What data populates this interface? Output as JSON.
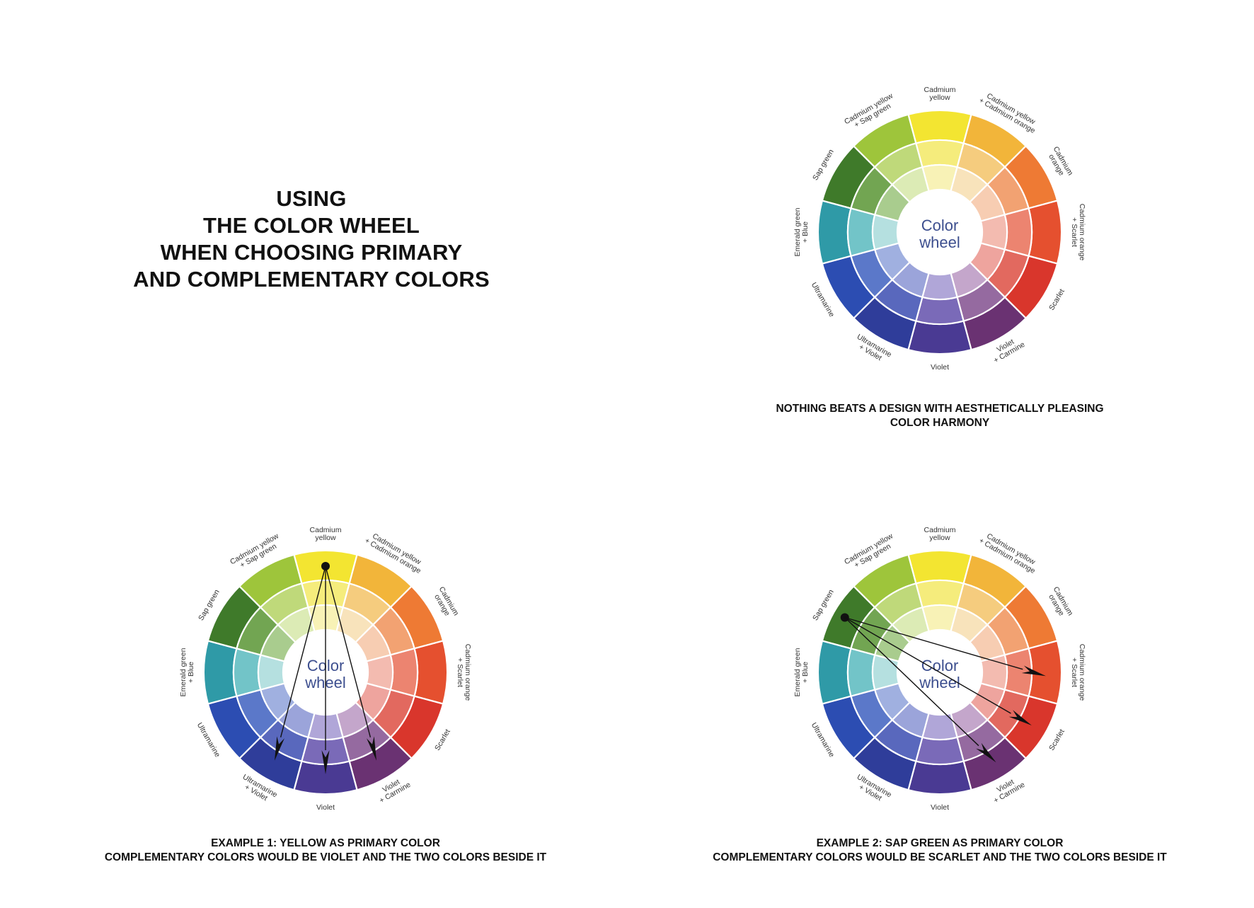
{
  "title_lines": [
    "USING",
    "THE COLOR WHEEL",
    "WHEN CHOOSING PRIMARY",
    "AND COMPLEMENTARY COLORS"
  ],
  "wheel": {
    "center_text": [
      "Color",
      "wheel"
    ],
    "segments": [
      {
        "label": [
          "Cadmium",
          "yellow"
        ],
        "colors": [
          "#f3e531",
          "#f5ec7c",
          "#f8f2b6"
        ]
      },
      {
        "label": [
          "Cadmium yellow",
          "+ Cadmium orange"
        ],
        "colors": [
          "#f2b53a",
          "#f5cc7e",
          "#f8e3bb"
        ]
      },
      {
        "label": [
          "Cadmium",
          "orange"
        ],
        "colors": [
          "#ee7a34",
          "#f2a272",
          "#f7cdb2"
        ]
      },
      {
        "label": [
          "Cadmium orange",
          "+ Scarlet"
        ],
        "colors": [
          "#e5502f",
          "#ec8470",
          "#f3bbb0"
        ]
      },
      {
        "label": [
          "Scarlet"
        ],
        "colors": [
          "#d9362c",
          "#e2695f",
          "#eea49e"
        ]
      },
      {
        "label": [
          "Violet",
          "+ Carmine"
        ],
        "colors": [
          "#6a3272",
          "#956aa0",
          "#c4a6cb"
        ]
      },
      {
        "label": [
          "Violet"
        ],
        "colors": [
          "#4a3a93",
          "#7a6ab8",
          "#b0a6d8"
        ]
      },
      {
        "label": [
          "Ultramarine",
          "+ Violet"
        ],
        "colors": [
          "#2f3d9a",
          "#5968bd",
          "#9ba4da"
        ]
      },
      {
        "label": [
          "Ultramarine"
        ],
        "colors": [
          "#2c4db2",
          "#5b78c9",
          "#a0b0e0"
        ]
      },
      {
        "label": [
          "Emerald green",
          "+ Blue"
        ],
        "colors": [
          "#2f9aa7",
          "#72c4c8",
          "#b5e0e0"
        ]
      },
      {
        "label": [
          "Sap green"
        ],
        "colors": [
          "#3f7a2a",
          "#72a552",
          "#a9cc8e"
        ]
      },
      {
        "label": [
          "Cadmium yellow",
          "+ Sap green"
        ],
        "colors": [
          "#9ec53b",
          "#bfd97a",
          "#dcebb5"
        ]
      }
    ]
  },
  "panels": [
    {
      "caption_lines": [
        "NOTHING BEATS A DESIGN WITH AESTHETICALLY PLEASING",
        "COLOR HARMONY"
      ]
    },
    {
      "caption_lines": [
        "EXAMPLE 1: YELLOW AS PRIMARY COLOR",
        "COMPLEMENTARY COLORS WOULD BE VIOLET AND THE TWO COLORS BESIDE IT"
      ]
    },
    {
      "caption_lines": [
        "EXAMPLE 2: SAP GREEN AS PRIMARY COLOR",
        "COMPLEMENTARY COLORS WOULD BE SCARLET AND THE TWO COLORS BESIDE IT"
      ]
    }
  ]
}
